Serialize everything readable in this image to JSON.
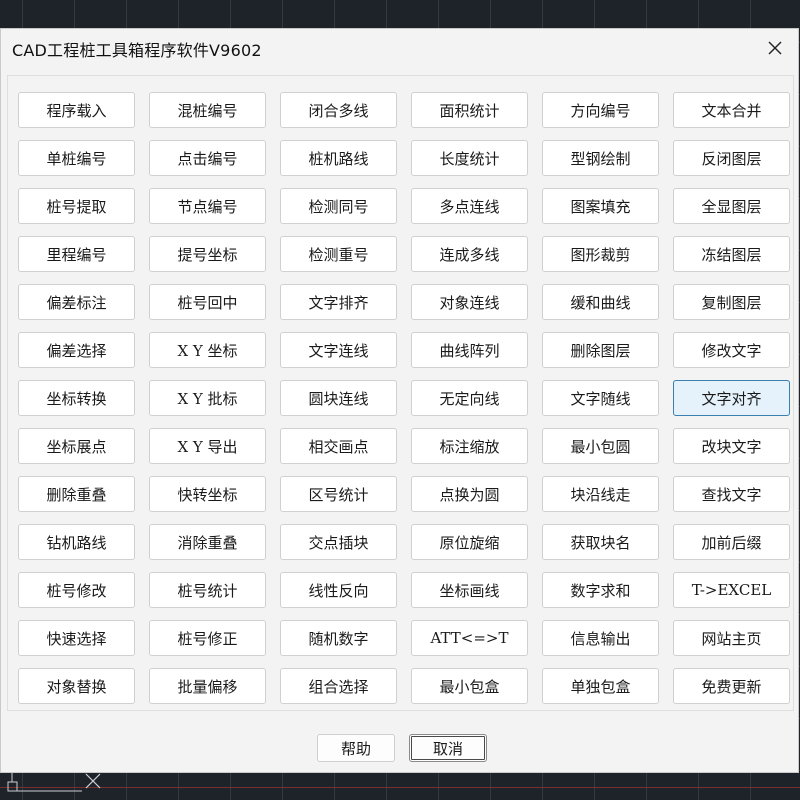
{
  "window": {
    "title": "CAD工程桩工具箱程序软件V9602"
  },
  "icons": {
    "close": "close-icon",
    "ucs": "ucs-icon"
  },
  "colors": {
    "dialog_bg": "#f3f3f3",
    "cad_background": "#1e2229",
    "focused_button_bg": "#e5f1fb",
    "focused_button_border": "#3c7fb1"
  },
  "tools": {
    "rows": [
      [
        "程序载入",
        "混桩编号",
        "闭合多线",
        "面积统计",
        "方向编号",
        "文本合并"
      ],
      [
        "单桩编号",
        "点击编号",
        "桩机路线",
        "长度统计",
        "型钢绘制",
        "反闭图层"
      ],
      [
        "桩号提取",
        "节点编号",
        "检测同号",
        "多点连线",
        "图案填充",
        "全显图层"
      ],
      [
        "里程编号",
        "提号坐标",
        "检测重号",
        "连成多线",
        "图形裁剪",
        "冻结图层"
      ],
      [
        "偏差标注",
        "桩号回中",
        "文字排齐",
        "对象连线",
        "缓和曲线",
        "复制图层"
      ],
      [
        "偏差选择",
        "X Y 坐标",
        "文字连线",
        "曲线阵列",
        "删除图层",
        "修改文字"
      ],
      [
        "坐标转换",
        "X Y 批标",
        "圆块连线",
        "无定向线",
        "文字随线",
        "文字对齐"
      ],
      [
        "坐标展点",
        "X Y 导出",
        "相交画点",
        "标注缩放",
        "最小包圆",
        "改块文字"
      ],
      [
        "删除重叠",
        "快转坐标",
        "区号统计",
        "点换为圆",
        "块沿线走",
        "查找文字"
      ],
      [
        "钻机路线",
        "消除重叠",
        "交点插块",
        "原位旋缩",
        "获取块名",
        "加前后缀"
      ],
      [
        "桩号修改",
        "桩号统计",
        "线性反向",
        "坐标画线",
        "数字求和",
        "T->EXCEL"
      ],
      [
        "快速选择",
        "桩号修正",
        "随机数字",
        "ATT<=>T",
        "信息输出",
        "网站主页"
      ],
      [
        "对象替换",
        "批量偏移",
        "组合选择",
        "最小包盒",
        "单独包盒",
        "免费更新"
      ]
    ],
    "focused": "文字对齐"
  },
  "footer": {
    "help_label": "帮助",
    "cancel_label": "取消"
  }
}
